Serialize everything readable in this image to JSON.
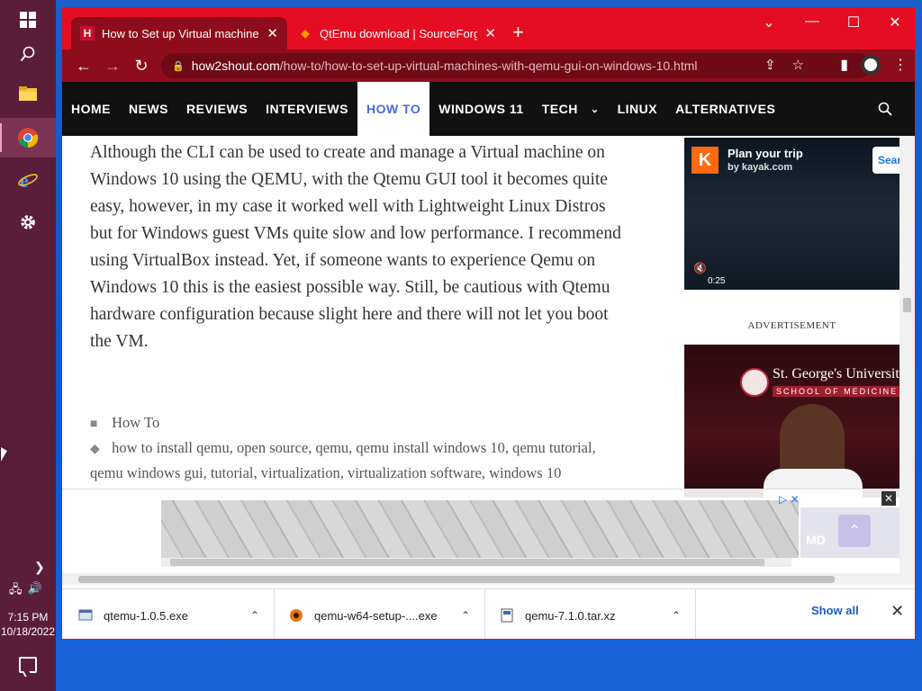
{
  "taskbar": {
    "apps": [
      {
        "name": "start",
        "icon": "windows-logo-icon"
      },
      {
        "name": "search",
        "icon": "search-icon"
      },
      {
        "name": "file-explorer",
        "icon": "folder-icon"
      },
      {
        "name": "chrome",
        "icon": "chrome-icon",
        "active": true
      },
      {
        "name": "internet-explorer",
        "icon": "ie-icon"
      },
      {
        "name": "settings",
        "icon": "gear-icon"
      }
    ],
    "clock": {
      "time": "7:15 PM",
      "date": "10/18/2022"
    }
  },
  "browser": {
    "tabs": [
      {
        "title": "How to Set up Virtual machines w",
        "favicon": "H",
        "active": true
      },
      {
        "title": "QtEmu download | SourceForge.n",
        "favicon": "◆",
        "active": false
      }
    ],
    "url_host": "how2shout.com",
    "url_path": "/how-to/how-to-set-up-virtual-machines-with-qemu-gui-on-windows-10.html",
    "theme_color": "#e50d22"
  },
  "site": {
    "nav": [
      "HOME",
      "NEWS",
      "REVIEWS",
      "INTERVIEWS",
      "HOW TO",
      "WINDOWS 11",
      "TECH",
      "LINUX",
      "ALTERNATIVES"
    ],
    "current_nav": "HOW TO",
    "article_text": "Although the CLI can be used to create and manage a Virtual machine on Windows 10 using the QEMU, with the Qtemu GUI tool it becomes quite easy, however, in my case it worked well with Lightweight Linux Distros but for Windows guest VMs quite slow and low performance. I recommend using VirtualBox instead. Yet, if someone wants to experience Qemu on Windows 10 this is the easiest possible way. Still, be cautious with Qtemu hardware configuration because slight here and there will not let you boot the VM.",
    "category": "How To",
    "tags": "how to install qemu, open source, qemu, qemu install windows 10, qemu tutorial, qemu windows gui, tutorial, virtualization, virtualization software, windows 10"
  },
  "ads": {
    "kayak_logo": "K",
    "kayak_title": "Plan your trip",
    "kayak_sub": "by kayak.com",
    "kayak_search": "Sear",
    "kayak_time": "0:25",
    "label": "ADVERTISEMENT",
    "sgu_title": "St. George's University",
    "sgu_sub": "SCHOOL OF MEDICINE",
    "banner_text": "MD"
  },
  "downloads": {
    "items": [
      "qtemu-1.0.5.exe",
      "qemu-w64-setup-....exe",
      "qemu-7.1.0.tar.xz"
    ],
    "show_all": "Show all"
  }
}
